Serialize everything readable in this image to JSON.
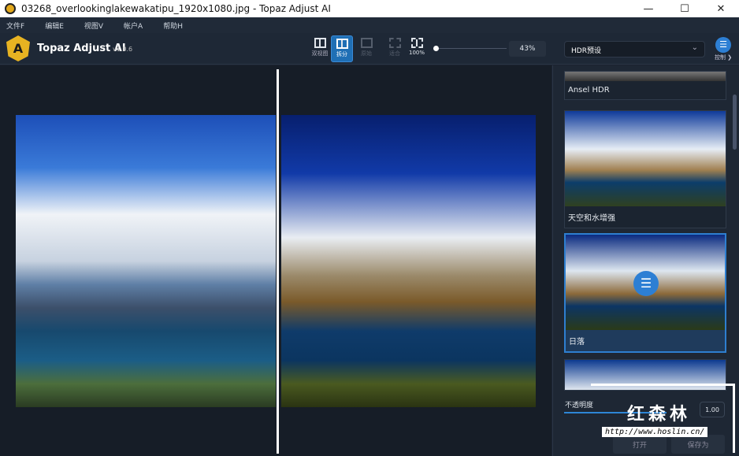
{
  "window": {
    "title": "03268_overlookinglakewakatipu_1920x1080.jpg - Topaz Adjust AI",
    "controls": [
      "—",
      "☐",
      "✕"
    ]
  },
  "menu": [
    "文件F",
    "编辑E",
    "视图V",
    "帐户A",
    "帮助H"
  ],
  "app": {
    "logo": "A",
    "name": "Topaz Adjust AI",
    "version": "v1.0.6"
  },
  "toolbar": {
    "dual_view": "双视图",
    "split": "拆分",
    "original": "原始",
    "fit": "适合",
    "actual": "100%",
    "zoom": "43%",
    "zoom_fraction": 0.0
  },
  "panel": {
    "preset_select": "HDR预设",
    "control_label": "控制 ❯",
    "presets": [
      {
        "label": "Ansel HDR"
      },
      {
        "label": "天空和水增强"
      },
      {
        "label": "日落",
        "selected": true
      }
    ],
    "opacity_label": "不透明度",
    "opacity_value": "1.00",
    "open": "打开",
    "save_as": "保存为"
  },
  "watermark": {
    "text": "红森林",
    "url": "http://www.hoslin.cn/"
  },
  "colors": {
    "accent": "#2e7fd0",
    "logo": "#e7b322"
  }
}
